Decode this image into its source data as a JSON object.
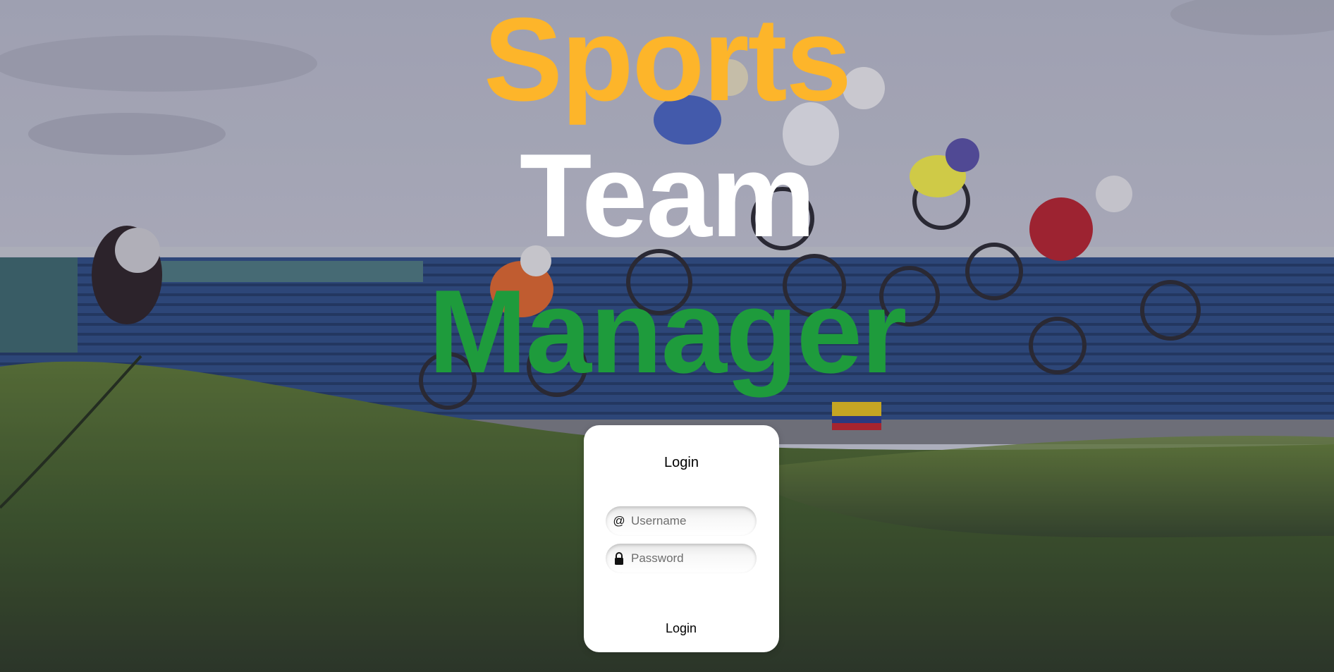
{
  "title": {
    "words": [
      "Sports",
      "Team",
      "Manager"
    ],
    "colors": [
      "#FDB52A",
      "#FFFFFF",
      "#1E9B3C"
    ]
  },
  "login": {
    "heading": "Login",
    "username_placeholder": "Username",
    "password_placeholder": "Password",
    "username_icon": "at-sign-icon",
    "password_icon": "lock-icon",
    "submit_label": "Login"
  },
  "background": {
    "scene": "bmx-race-photo"
  }
}
